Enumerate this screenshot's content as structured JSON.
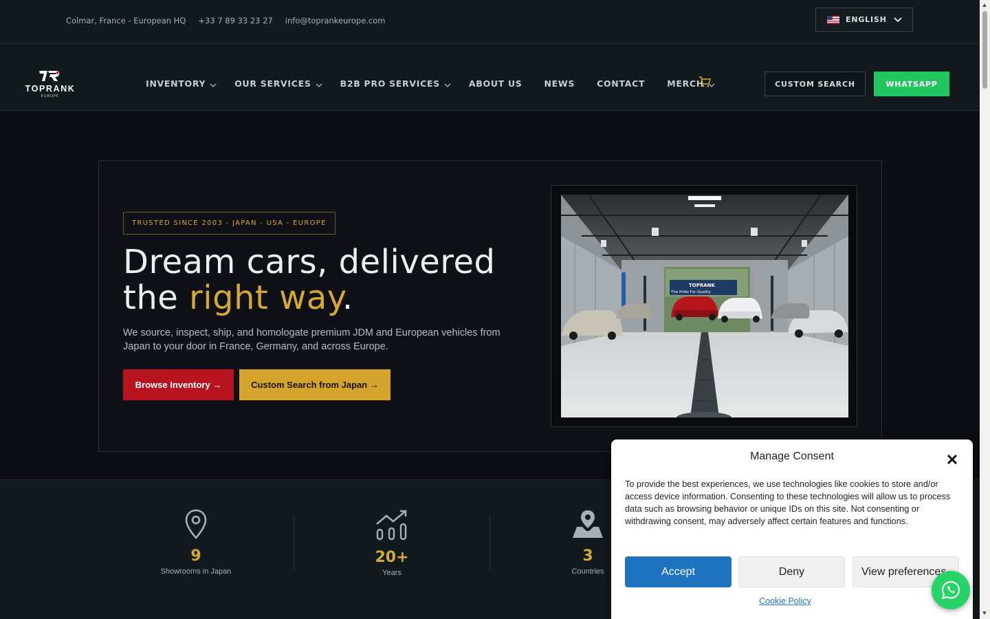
{
  "topbar": {
    "location": "Colmar, France - European HQ",
    "phone": "+33 7 89 33 23 27",
    "email": "info@toprankeurope.com",
    "language": "ENGLISH"
  },
  "brand": {
    "name": "TOPRANK",
    "sub": "EUROPE"
  },
  "nav": {
    "items": [
      {
        "label": "INVENTORY",
        "dropdown": true
      },
      {
        "label": "OUR SERVICES",
        "dropdown": true
      },
      {
        "label": "B2B PRO SERVICES",
        "dropdown": true
      },
      {
        "label": "ABOUT US",
        "dropdown": false
      },
      {
        "label": "NEWS",
        "dropdown": false
      },
      {
        "label": "CONTACT",
        "dropdown": false
      },
      {
        "label": "MERCH",
        "dropdown": true
      }
    ],
    "custom_search": "CUSTOM SEARCH",
    "whatsapp": "WHATSAPP"
  },
  "hero": {
    "badge": "TRUSTED SINCE 2003 - JAPAN - USA - EUROPE",
    "title_line1": "Dream cars, delivered",
    "title_the": "the ",
    "title_gold": "right way",
    "title_dot": ".",
    "lead": "We source, inspect, ship, and homologate premium JDM and European vehicles from Japan to your door in France, Germany, and across Europe.",
    "browse": "Browse Inventory →",
    "custom": "Custom Search from Japan →",
    "photo_sign": "TOPRANK",
    "photo_sign_sub": "The Pride For Quality"
  },
  "stats": [
    {
      "value": "9",
      "label": "Showrooms in Japan",
      "icon": "map-pin-icon"
    },
    {
      "value": "20+",
      "label": "Years",
      "icon": "growth-chart-icon"
    },
    {
      "value": "3",
      "label": "Countries",
      "icon": "map-marker-icon"
    }
  ],
  "consent": {
    "title": "Manage Consent",
    "text": "To provide the best experiences, we use technologies like cookies to store and/or access device information. Consenting to these technologies will allow us to process data such as browsing behavior or unique IDs on this site. Not consenting or withdrawing consent, may adversely affect certain features and functions.",
    "accept": "Accept",
    "deny": "Deny",
    "preferences": "View preferences",
    "policy": "Cookie Policy"
  },
  "colors": {
    "gold": "#d4a934",
    "red": "#b8141f",
    "green": "#22c55e",
    "blue": "#1e73be",
    "bg": "#0d0e13"
  }
}
